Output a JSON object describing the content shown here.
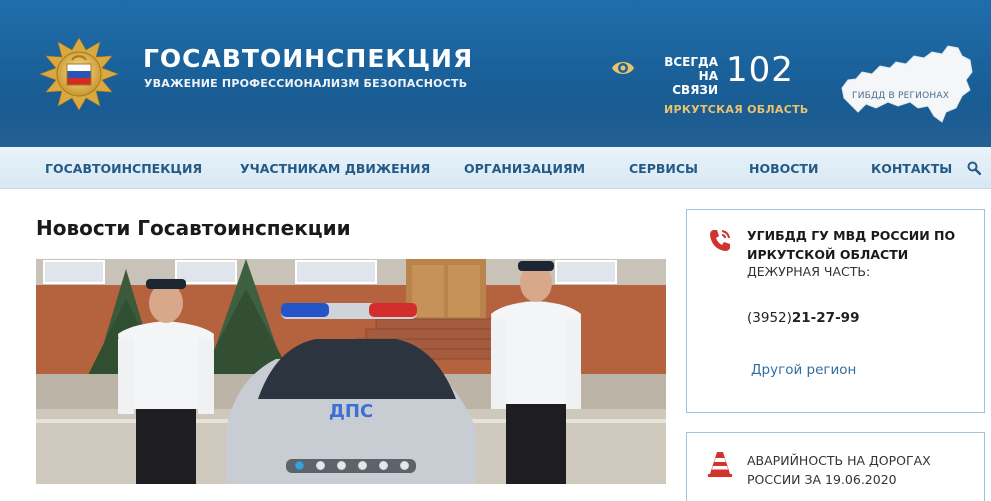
{
  "header": {
    "brand_title": "ГОСАВТОИНСПЕКЦИЯ",
    "brand_subtitle": "УВАЖЕНИЕ ПРОФЕССИОНАЛИЗМ БЕЗОПАСНОСТЬ",
    "always_line1": "ВСЕГДА",
    "always_line2": "НА СВЯЗИ",
    "hotline": "102",
    "region": "ИРКУТСКАЯ ОБЛАСТЬ",
    "map_label": "ГИБДД В РЕГИОНАХ"
  },
  "nav": {
    "items": [
      {
        "label": "ГОСАВТОИНСПЕКЦИЯ"
      },
      {
        "label": "УЧАСТНИКАМ ДВИЖЕНИЯ"
      },
      {
        "label": "ОРГАНИЗАЦИЯМ"
      },
      {
        "label": "СЕРВИСЫ"
      },
      {
        "label": "НОВОСТИ"
      },
      {
        "label": "КОНТАКТЫ"
      }
    ],
    "search_icon": "search-icon"
  },
  "main": {
    "title": "Новости Госавтоинспекции",
    "slider": {
      "dot_count": 6,
      "active_index": 0
    },
    "photo_car_text": "ДПС"
  },
  "sidebar": {
    "contact": {
      "title": "УГИБДД ГУ МВД РОССИИ ПО ИРКУТСКОЙ ОБЛАСТИ",
      "subtitle": "ДЕЖУРНАЯ ЧАСТЬ:",
      "phone_code": "(3952)",
      "phone_number": "21-27-99",
      "other_region": "Другой регион"
    },
    "accident": {
      "text": "АВАРИЙНОСТЬ НА ДОРОГАХ РОССИИ ЗА 19.06.2020"
    }
  },
  "colors": {
    "header_blue": "#1a5f98",
    "nav_text": "#245a85",
    "accent_gold": "#e8c36e",
    "icon_red": "#d0342c",
    "link_blue": "#2f6ea3",
    "card_border": "#9fc3de"
  }
}
